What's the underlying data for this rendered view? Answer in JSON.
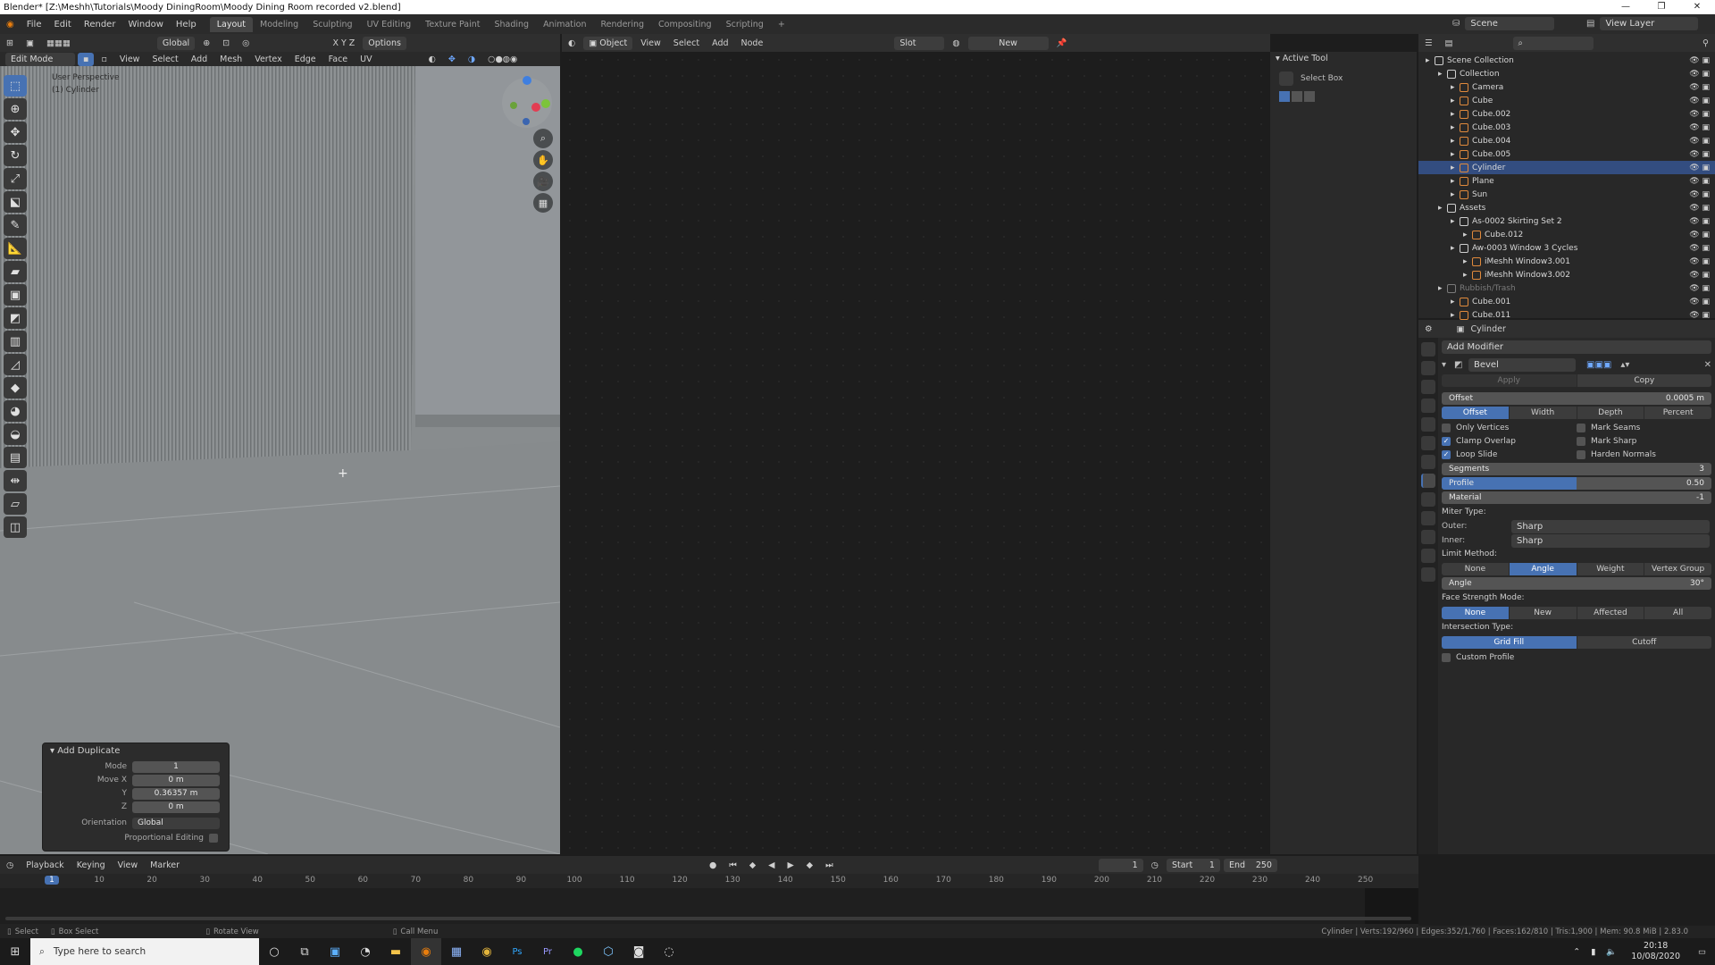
{
  "titlebar": {
    "title": "Blender* [Z:\\Meshh\\Tutorials\\Moody DiningRoom\\Moody Dining Room recorded v2.blend]",
    "minimize": "—",
    "restore": "❐",
    "close": "✕"
  },
  "menu": {
    "items": [
      "File",
      "Edit",
      "Render",
      "Window",
      "Help"
    ]
  },
  "workspaces": [
    "Layout",
    "Modeling",
    "Sculpting",
    "UV Editing",
    "Texture Paint",
    "Shading",
    "Animation",
    "Rendering",
    "Compositing",
    "Scripting",
    "+"
  ],
  "scene": {
    "label": "Scene",
    "viewlayer": "View Layer"
  },
  "viewport": {
    "mode": "Edit Mode",
    "header_menus": [
      "View",
      "Select",
      "Add",
      "Mesh",
      "Vertex",
      "Edge",
      "Face",
      "UV"
    ],
    "orientation": "Global",
    "options": "Options",
    "axes": "X Y Z",
    "overlay_title": "User Perspective",
    "overlay_object": "(1) Cylinder",
    "gizmo": {
      "x": "X",
      "y": "Y",
      "z": "Z"
    }
  },
  "redo_panel": {
    "title": "Add Duplicate",
    "rows": [
      {
        "label": "Mode",
        "value": "1"
      },
      {
        "label": "Move X",
        "value": "0 m"
      },
      {
        "label": "Y",
        "value": "0.36357 m"
      },
      {
        "label": "Z",
        "value": "0 m"
      },
      {
        "label": "Orientation",
        "value": "Global"
      }
    ],
    "proportional": "Proportional Editing"
  },
  "node_editor": {
    "type": "Object",
    "menus": [
      "View",
      "Select",
      "Add",
      "Node"
    ],
    "slot": "Slot",
    "new": "New"
  },
  "active_tool": {
    "title": "Active Tool",
    "tool": "Select Box"
  },
  "outliner": {
    "rows": [
      {
        "name": "Scene Collection",
        "indent": 0,
        "color": "#cfcfcf",
        "sel": false
      },
      {
        "name": "Collection",
        "indent": 1,
        "color": "#cfcfcf",
        "sel": false
      },
      {
        "name": "Camera",
        "indent": 2,
        "color": "#e08a3c",
        "sel": false
      },
      {
        "name": "Cube",
        "indent": 2,
        "color": "#e08a3c",
        "sel": false
      },
      {
        "name": "Cube.002",
        "indent": 2,
        "color": "#e08a3c",
        "sel": false
      },
      {
        "name": "Cube.003",
        "indent": 2,
        "color": "#e08a3c",
        "sel": false
      },
      {
        "name": "Cube.004",
        "indent": 2,
        "color": "#e08a3c",
        "sel": false
      },
      {
        "name": "Cube.005",
        "indent": 2,
        "color": "#e08a3c",
        "sel": false
      },
      {
        "name": "Cylinder",
        "indent": 2,
        "color": "#e08a3c",
        "sel": true
      },
      {
        "name": "Plane",
        "indent": 2,
        "color": "#e08a3c",
        "sel": false
      },
      {
        "name": "Sun",
        "indent": 2,
        "color": "#e08a3c",
        "sel": false
      },
      {
        "name": "Assets",
        "indent": 1,
        "color": "#cfcfcf",
        "sel": false
      },
      {
        "name": "As-0002 Skirting Set 2",
        "indent": 2,
        "color": "#cfcfcf",
        "sel": false
      },
      {
        "name": "Cube.012",
        "indent": 3,
        "color": "#e08a3c",
        "sel": false
      },
      {
        "name": "Aw-0003 Window 3 Cycles",
        "indent": 2,
        "color": "#cfcfcf",
        "sel": false
      },
      {
        "name": "iMeshh Window3.001",
        "indent": 3,
        "color": "#e08a3c",
        "sel": false
      },
      {
        "name": "iMeshh Window3.002",
        "indent": 3,
        "color": "#e08a3c",
        "sel": false
      },
      {
        "name": "Rubbish/Trash",
        "indent": 1,
        "color": "#7a7a7a",
        "sel": false
      },
      {
        "name": "Cube.001",
        "indent": 2,
        "color": "#e08a3c",
        "sel": false
      },
      {
        "name": "Cube.011",
        "indent": 2,
        "color": "#e08a3c",
        "sel": false
      }
    ]
  },
  "properties": {
    "object": "Cylinder",
    "add_modifier": "Add Modifier",
    "modifier_name": "Bevel",
    "apply": "Apply",
    "copy": "Copy",
    "offset": {
      "label": "Offset",
      "value": "0.0005 m"
    },
    "width_type": [
      "Offset",
      "Width",
      "Depth",
      "Percent"
    ],
    "checks_left": [
      {
        "label": "Only Vertices",
        "on": false
      },
      {
        "label": "Clamp Overlap",
        "on": true
      },
      {
        "label": "Loop Slide",
        "on": true
      }
    ],
    "checks_right": [
      {
        "label": "Mark Seams",
        "on": false
      },
      {
        "label": "Mark Sharp",
        "on": false
      },
      {
        "label": "Harden Normals",
        "on": false
      }
    ],
    "segments": {
      "label": "Segments",
      "value": "3"
    },
    "profile": {
      "label": "Profile",
      "value": "0.50",
      "fraction": 0.5
    },
    "material": {
      "label": "Material",
      "value": "-1"
    },
    "miter_type": "Miter Type:",
    "outer": {
      "label": "Outer:",
      "value": "Sharp"
    },
    "inner": {
      "label": "Inner:",
      "value": "Sharp"
    },
    "limit_method": "Limit Method:",
    "limit_options": [
      "None",
      "Angle",
      "Weight",
      "Vertex Group"
    ],
    "angle": {
      "label": "Angle",
      "value": "30°"
    },
    "face_strength": "Face Strength Mode:",
    "face_options": [
      "None",
      "New",
      "Affected",
      "All"
    ],
    "intersection": "Intersection Type:",
    "intersection_options": [
      "Grid Fill",
      "Cutoff"
    ],
    "custom_profile": "Custom Profile"
  },
  "timeline": {
    "menus": [
      "Playback",
      "Keying",
      "View",
      "Marker"
    ],
    "current": "1",
    "start_label": "Start",
    "start": "1",
    "end_label": "End",
    "end": "250",
    "ticks": [
      "1",
      "10",
      "20",
      "30",
      "40",
      "50",
      "60",
      "70",
      "80",
      "90",
      "100",
      "110",
      "120",
      "130",
      "140",
      "150",
      "160",
      "170",
      "180",
      "190",
      "200",
      "210",
      "220",
      "230",
      "240",
      "250"
    ]
  },
  "statusbar": {
    "select": "Select",
    "box_select": "Box Select",
    "rotate_view": "Rotate View",
    "call_menu": "Call Menu",
    "stats": "Cylinder | Verts:192/960 | Edges:352/1,760 | Faces:162/810 | Tris:1,900 | Mem: 90.8 MiB | 2.83.0"
  },
  "taskbar": {
    "search": "Type here to search",
    "time": "20:18",
    "date": "10/08/2020"
  }
}
